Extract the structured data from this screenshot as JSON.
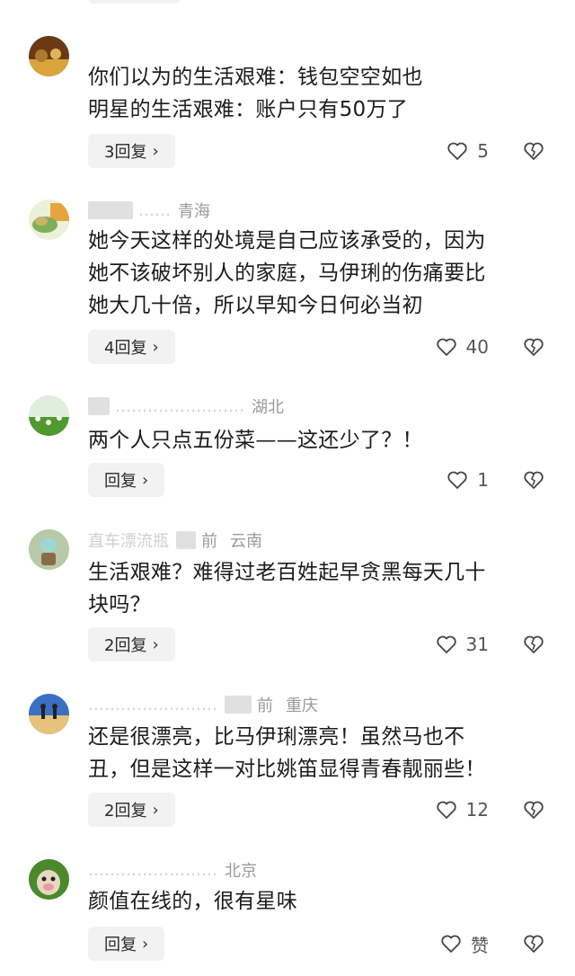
{
  "comments": [
    {
      "location": "",
      "lines": [
        "你们以为的生活艰难：钱包空空如也",
        "明星的生活艰难：账户只有50万了"
      ],
      "reply_label": "3回复",
      "likes": "5",
      "avatar_colors": [
        "#6b3a14",
        "#d9a43b"
      ]
    },
    {
      "location": "青海",
      "lines": [
        "她今天这样的处境是自己应该承受的，因为",
        "她不该破坏别人的家庭，马伊琍的伤痛要比",
        "她大几十倍，所以早知今日何必当初"
      ],
      "reply_label": "4回复",
      "likes": "40",
      "avatar_colors": [
        "#7fae5a",
        "#e8a43c"
      ]
    },
    {
      "location": "湖北",
      "lines": [
        "两个人只点五份菜——这还少了？！"
      ],
      "reply_label": "回复",
      "likes": "1",
      "avatar_colors": [
        "#4e9a2e",
        "#cfe8b0"
      ]
    },
    {
      "location": "云南",
      "name_fragment": "直车漂流瓶",
      "time_fragment": "前",
      "lines": [
        "生活艰难？难得过老百姓起早贪黑每天几十",
        "块吗？"
      ],
      "reply_label": "2回复",
      "likes": "31",
      "avatar_colors": [
        "#b7c9a6",
        "#8b6a4a"
      ]
    },
    {
      "location": "重庆",
      "time_fragment": "前",
      "lines": [
        "还是很漂亮，比马伊琍漂亮！虽然马也不",
        "丑，但是这样一对比姚笛显得青春靓丽些！"
      ],
      "reply_label": "2回复",
      "likes": "12",
      "avatar_colors": [
        "#3a6fc4",
        "#e6c27a"
      ]
    },
    {
      "location": "北京",
      "lines": [
        "颜值在线的，很有星味"
      ],
      "reply_label": "回复",
      "likes": "赞",
      "avatar_colors": [
        "#4a8a2a",
        "#e9d7c2"
      ]
    }
  ],
  "icons": {
    "like": "heart-outline-icon",
    "dislike": "broken-heart-icon",
    "chevron": "chevron-right-icon"
  },
  "ui": {
    "chevron_glyph": "›"
  }
}
